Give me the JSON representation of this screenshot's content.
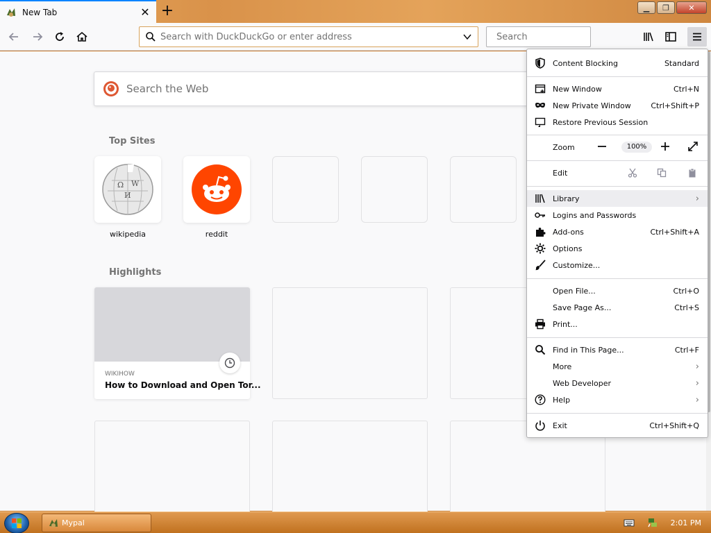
{
  "tab": {
    "title": "New Tab"
  },
  "navbar": {
    "url_placeholder": "Search with DuckDuckGo or enter address",
    "search_placeholder": "Search"
  },
  "newtab": {
    "web_search_placeholder": "Search the Web",
    "top_sites_title": "Top Sites",
    "top_sites": [
      {
        "label": "wikipedia",
        "icon": "wikipedia-logo"
      },
      {
        "label": "reddit",
        "icon": "reddit-logo"
      }
    ],
    "highlights_title": "Highlights",
    "highlights": [
      {
        "source": "WIKIHOW",
        "title": "How to Download and Open Tor..."
      }
    ]
  },
  "menu": {
    "content_blocking": {
      "label": "Content Blocking",
      "value": "Standard"
    },
    "new_window": {
      "label": "New Window",
      "shortcut": "Ctrl+N"
    },
    "new_private_window": {
      "label": "New Private Window",
      "shortcut": "Ctrl+Shift+P"
    },
    "restore_session": {
      "label": "Restore Previous Session"
    },
    "zoom": {
      "label": "Zoom",
      "level": "100%"
    },
    "edit": {
      "label": "Edit"
    },
    "library": {
      "label": "Library"
    },
    "logins": {
      "label": "Logins and Passwords"
    },
    "addons": {
      "label": "Add-ons",
      "shortcut": "Ctrl+Shift+A"
    },
    "options": {
      "label": "Options"
    },
    "customize": {
      "label": "Customize..."
    },
    "open_file": {
      "label": "Open File...",
      "shortcut": "Ctrl+O"
    },
    "save_page": {
      "label": "Save Page As...",
      "shortcut": "Ctrl+S"
    },
    "print": {
      "label": "Print..."
    },
    "find": {
      "label": "Find in This Page...",
      "shortcut": "Ctrl+F"
    },
    "more": {
      "label": "More"
    },
    "web_developer": {
      "label": "Web Developer"
    },
    "help": {
      "label": "Help"
    },
    "exit": {
      "label": "Exit",
      "shortcut": "Ctrl+Shift+Q"
    }
  },
  "taskbar": {
    "app_label": "Mypal",
    "clock": "2:01 PM"
  },
  "colors": {
    "accent": "#0a84ff",
    "reddit": "#ff4500",
    "taskbar": "#c8782a"
  }
}
